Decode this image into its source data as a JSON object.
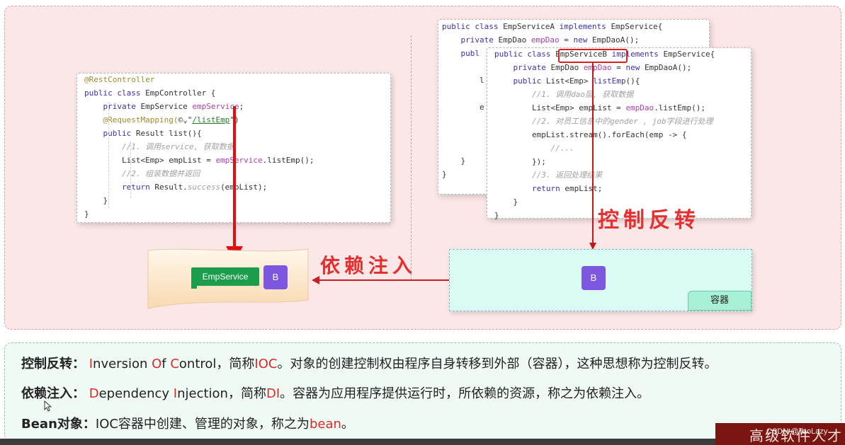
{
  "diagram": {
    "controller_code": [
      [
        {
          "t": "@RestController",
          "c": "ann"
        }
      ],
      [
        {
          "t": "public class ",
          "c": "kw"
        },
        {
          "t": "EmpController {",
          "c": ""
        }
      ],
      [
        {
          "t": "    private ",
          "c": "kw"
        },
        {
          "t": "EmpService ",
          "c": ""
        },
        {
          "t": "empService",
          "c": "fld"
        },
        {
          "t": ";",
          "c": ""
        }
      ],
      [
        {
          "t": "    @RequestMapping(",
          "c": "ann"
        },
        {
          "t": "©⌄\"",
          "c": ""
        },
        {
          "t": "/listEmp",
          "c": "str"
        },
        {
          "t": "\")",
          "c": ""
        }
      ],
      [
        {
          "t": "    public ",
          "c": "kw"
        },
        {
          "t": "Result list(){",
          "c": ""
        }
      ],
      [
        {
          "t": "        //1. 调用service, 获取数据",
          "c": "cmt"
        }
      ],
      [
        {
          "t": "        List<Emp> empList = ",
          "c": ""
        },
        {
          "t": "empService",
          "c": "fld"
        },
        {
          "t": ".listEmp();",
          "c": ""
        }
      ],
      [
        {
          "t": "        //2. 组装数据并返回",
          "c": "cmt"
        }
      ],
      [
        {
          "t": "        return ",
          "c": "kw"
        },
        {
          "t": "Result.",
          "c": ""
        },
        {
          "t": "success",
          "c": "cmt"
        },
        {
          "t": "(empList);",
          "c": ""
        }
      ],
      [
        {
          "t": "    }",
          "c": ""
        }
      ],
      [
        {
          "t": "}",
          "c": ""
        }
      ]
    ],
    "service_a_code": [
      [
        {
          "t": "public class ",
          "c": "kw"
        },
        {
          "t": "EmpServiceA ",
          "c": ""
        },
        {
          "t": "implements ",
          "c": "kw"
        },
        {
          "t": "EmpService{",
          "c": ""
        }
      ],
      [
        {
          "t": "    private ",
          "c": "kw"
        },
        {
          "t": "EmpDao ",
          "c": ""
        },
        {
          "t": "empDao",
          "c": "fld"
        },
        {
          "t": " = ",
          "c": ""
        },
        {
          "t": "new ",
          "c": "kw"
        },
        {
          "t": "EmpDaoA();",
          "c": ""
        }
      ],
      [
        {
          "t": "    publ",
          "c": "kw"
        }
      ],
      [
        {
          "t": "",
          "c": ""
        }
      ],
      [
        {
          "t": "        l",
          "c": ""
        }
      ],
      [
        {
          "t": "",
          "c": ""
        }
      ],
      [
        {
          "t": "        e",
          "c": ""
        }
      ],
      [
        {
          "t": "",
          "c": ""
        }
      ],
      [
        {
          "t": "",
          "c": ""
        }
      ],
      [
        {
          "t": "",
          "c": ""
        }
      ],
      [
        {
          "t": "    }",
          "c": ""
        }
      ],
      [
        {
          "t": "}",
          "c": ""
        }
      ]
    ],
    "service_b_code": [
      [
        {
          "t": "public class ",
          "c": "kw"
        },
        {
          "t": "EmpServiceB",
          "c": "boxed"
        },
        {
          "t": " implements ",
          "c": "kw"
        },
        {
          "t": "EmpService{",
          "c": ""
        }
      ],
      [
        {
          "t": "    private ",
          "c": "kw"
        },
        {
          "t": "EmpDao ",
          "c": ""
        },
        {
          "t": "empDao",
          "c": "fld"
        },
        {
          "t": " = ",
          "c": ""
        },
        {
          "t": "new ",
          "c": "kw"
        },
        {
          "t": "EmpDaoA();",
          "c": ""
        }
      ],
      [
        {
          "t": "    public ",
          "c": "kw"
        },
        {
          "t": "List<Emp> ",
          "c": ""
        },
        {
          "t": "listEmp",
          "c": "kw"
        },
        {
          "t": "(){",
          "c": ""
        }
      ],
      [
        {
          "t": "        //1. 调用dao层, 获取数据",
          "c": "cmt"
        }
      ],
      [
        {
          "t": "        List<Emp> empList = ",
          "c": ""
        },
        {
          "t": "empDao",
          "c": "fld"
        },
        {
          "t": ".listEmp();",
          "c": ""
        }
      ],
      [
        {
          "t": "        //2. 对员工信息中的gender , job字段进行处理",
          "c": "cmt"
        }
      ],
      [
        {
          "t": "        empList.stream().forEach(emp -> {",
          "c": ""
        }
      ],
      [
        {
          "t": "            //...",
          "c": "cmt"
        }
      ],
      [
        {
          "t": "        });",
          "c": ""
        }
      ],
      [
        {
          "t": "        //3. 返回处理结果",
          "c": "cmt"
        }
      ],
      [
        {
          "t": "        return ",
          "c": "kw"
        },
        {
          "t": "empList;",
          "c": ""
        }
      ],
      [
        {
          "t": "    }",
          "c": ""
        }
      ],
      [
        {
          "t": "}",
          "c": ""
        }
      ]
    ],
    "ioc_label": "控制反转",
    "di_label": "依赖注入",
    "emp_service_tag": "EmpService",
    "bean_letter": "B",
    "container_label": "容器"
  },
  "definitions": [
    {
      "term": "控制反转：",
      "parts": [
        {
          "t": " ",
          "r": false
        },
        {
          "t": "I",
          "r": true
        },
        {
          "t": "nversion ",
          "r": false
        },
        {
          "t": "O",
          "r": true
        },
        {
          "t": "f ",
          "r": false
        },
        {
          "t": "C",
          "r": true
        },
        {
          "t": "ontrol，简称",
          "r": false
        },
        {
          "t": "IOC",
          "r": true
        },
        {
          "t": "。对象的创建控制权由程序自身转移到外部（容器），这种思想称为控制反转。",
          "r": false
        }
      ]
    },
    {
      "term": "依赖注入：",
      "parts": [
        {
          "t": " ",
          "r": false
        },
        {
          "t": "D",
          "r": true
        },
        {
          "t": "ependency ",
          "r": false
        },
        {
          "t": "I",
          "r": true
        },
        {
          "t": "njection，简称",
          "r": false
        },
        {
          "t": "DI",
          "r": true
        },
        {
          "t": "。容器为应用程序提供运行时，所依赖的资源，称之为依赖注入。",
          "r": false
        }
      ]
    },
    {
      "term": "Bean对象：",
      "parts": [
        {
          "t": "IOC容器中创建、管理的对象，称之为",
          "r": false
        },
        {
          "t": "bean",
          "r": true
        },
        {
          "t": "。",
          "r": false
        }
      ]
    }
  ],
  "footer": {
    "corner_text": "高级软件人才",
    "watermark": "CSDN @TaoLazy"
  },
  "colors": {
    "accent_red": "#e01010",
    "tag_green": "#1b9d4b",
    "bean_purple": "#7d57e0",
    "container_bg": "#d9fbf3"
  }
}
